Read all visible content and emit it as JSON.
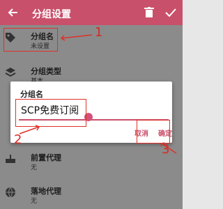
{
  "header": {
    "title": "分组设置",
    "back_icon": "back-arrow-icon",
    "delete_icon": "trash-icon",
    "confirm_icon": "check-icon"
  },
  "settings": {
    "group_name": {
      "label": "分组名",
      "value": "未设置",
      "icon": "tag-icon"
    },
    "group_type": {
      "label": "分组类型",
      "value": "基本",
      "icon": "layers-icon"
    },
    "front_proxy": {
      "label": "前置代理",
      "value": "无",
      "icon": "router-icon"
    },
    "landing_proxy": {
      "label": "落地代理",
      "value": "无",
      "icon": "globe-icon"
    }
  },
  "dialog": {
    "title": "分组名",
    "input_value": "SCP免费订阅",
    "cancel_label": "取消",
    "ok_label": "确定"
  },
  "annotations": {
    "n1": "1",
    "n2": "2",
    "n3": "3",
    "color": "#e0302a"
  },
  "colors": {
    "accent": "#c9506a",
    "topbar": "#c9506a"
  }
}
